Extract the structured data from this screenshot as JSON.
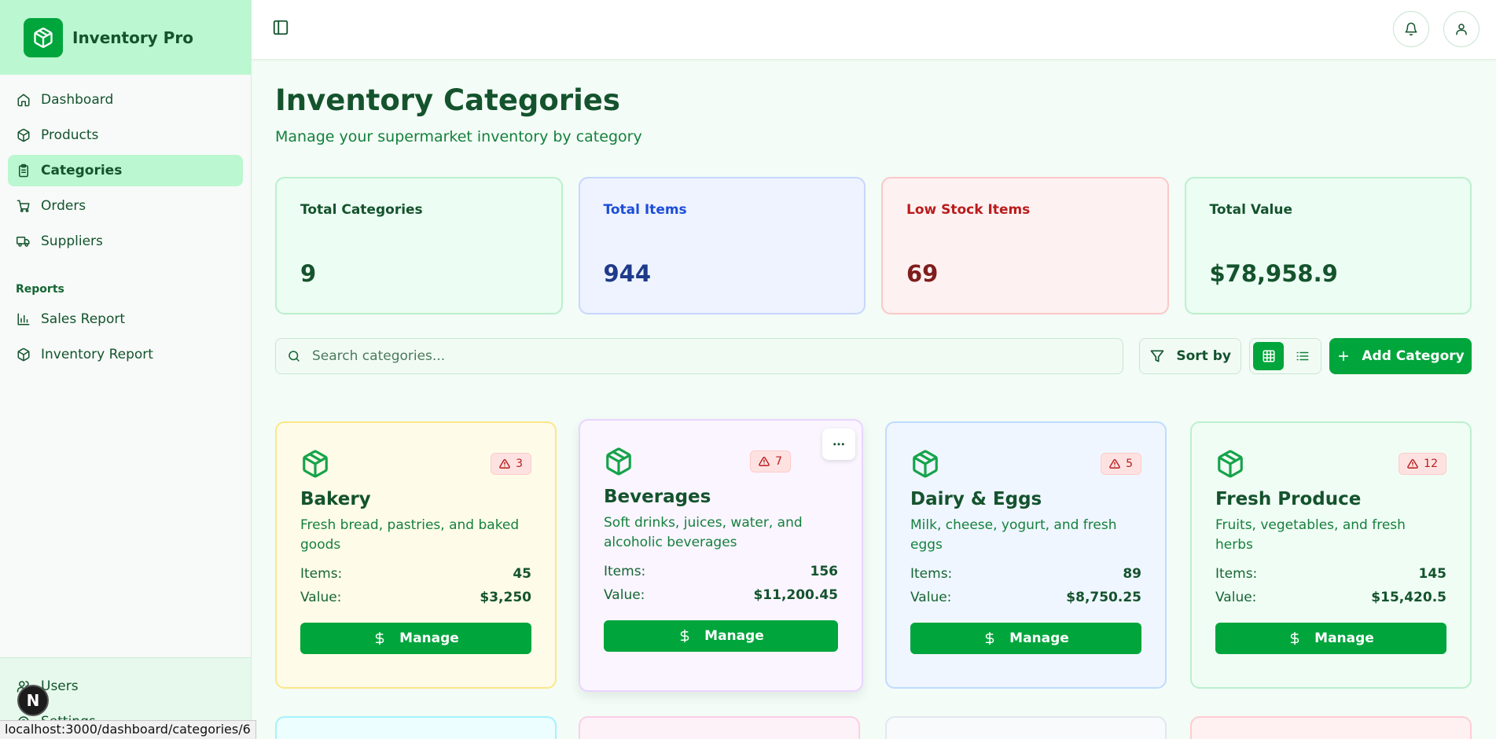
{
  "app": {
    "name": "Inventory Pro"
  },
  "sidebar": {
    "items": [
      {
        "label": "Dashboard",
        "icon": "home-icon"
      },
      {
        "label": "Products",
        "icon": "package-icon"
      },
      {
        "label": "Categories",
        "icon": "clipboard-icon",
        "active": true
      },
      {
        "label": "Orders",
        "icon": "cart-icon"
      },
      {
        "label": "Suppliers",
        "icon": "truck-icon"
      }
    ],
    "reports_heading": "Reports",
    "reports": [
      {
        "label": "Sales Report",
        "icon": "bar-chart-icon"
      },
      {
        "label": "Inventory Report",
        "icon": "package-icon"
      }
    ],
    "bottom": [
      {
        "label": "Users",
        "icon": "users-icon"
      },
      {
        "label": "Settings",
        "icon": "gear-icon"
      }
    ]
  },
  "page": {
    "title": "Inventory Categories",
    "subtitle": "Manage your supermarket inventory by category"
  },
  "stats": [
    {
      "label": "Total Categories",
      "value": "9",
      "color": "#14532d"
    },
    {
      "label": "Total Items",
      "value": "944",
      "color": "#1e3a8a"
    },
    {
      "label": "Low Stock Items",
      "value": "69",
      "color": "#7f1d1d"
    },
    {
      "label": "Total Value",
      "value": "$78,958.9",
      "color": "#14532d"
    }
  ],
  "toolbar": {
    "search_placeholder": "Search categories...",
    "sort_label": "Sort by",
    "add_label": "Add Category",
    "view_mode": "grid"
  },
  "categories": [
    {
      "name": "Bakery",
      "description": "Fresh bread, pastries, and baked goods",
      "low_stock": "3",
      "items_label": "Items:",
      "items": "45",
      "value_label": "Value:",
      "value": "$3,250",
      "manage_label": "Manage",
      "theme": "yellow"
    },
    {
      "name": "Beverages",
      "description": "Soft drinks, juices, water, and alcoholic beverages",
      "low_stock": "7",
      "items_label": "Items:",
      "items": "156",
      "value_label": "Value:",
      "value": "$11,200.45",
      "manage_label": "Manage",
      "theme": "purple"
    },
    {
      "name": "Dairy & Eggs",
      "description": "Milk, cheese, yogurt, and fresh eggs",
      "low_stock": "5",
      "items_label": "Items:",
      "items": "89",
      "value_label": "Value:",
      "value": "$8,750.25",
      "manage_label": "Manage",
      "theme": "blue"
    },
    {
      "name": "Fresh Produce",
      "description": "Fruits, vegetables, and fresh herbs",
      "low_stock": "12",
      "items_label": "Items:",
      "items": "145",
      "value_label": "Value:",
      "value": "$15,420.5",
      "manage_label": "Manage",
      "theme": "green"
    }
  ],
  "status_bar": {
    "url": "localhost:3000/dashboard/categories/6"
  },
  "dev_badge": {
    "letter": "N"
  },
  "colors": {
    "accent": "#00a53c",
    "brand_bg": "#bbf7d0",
    "danger": "#b91c1c"
  }
}
